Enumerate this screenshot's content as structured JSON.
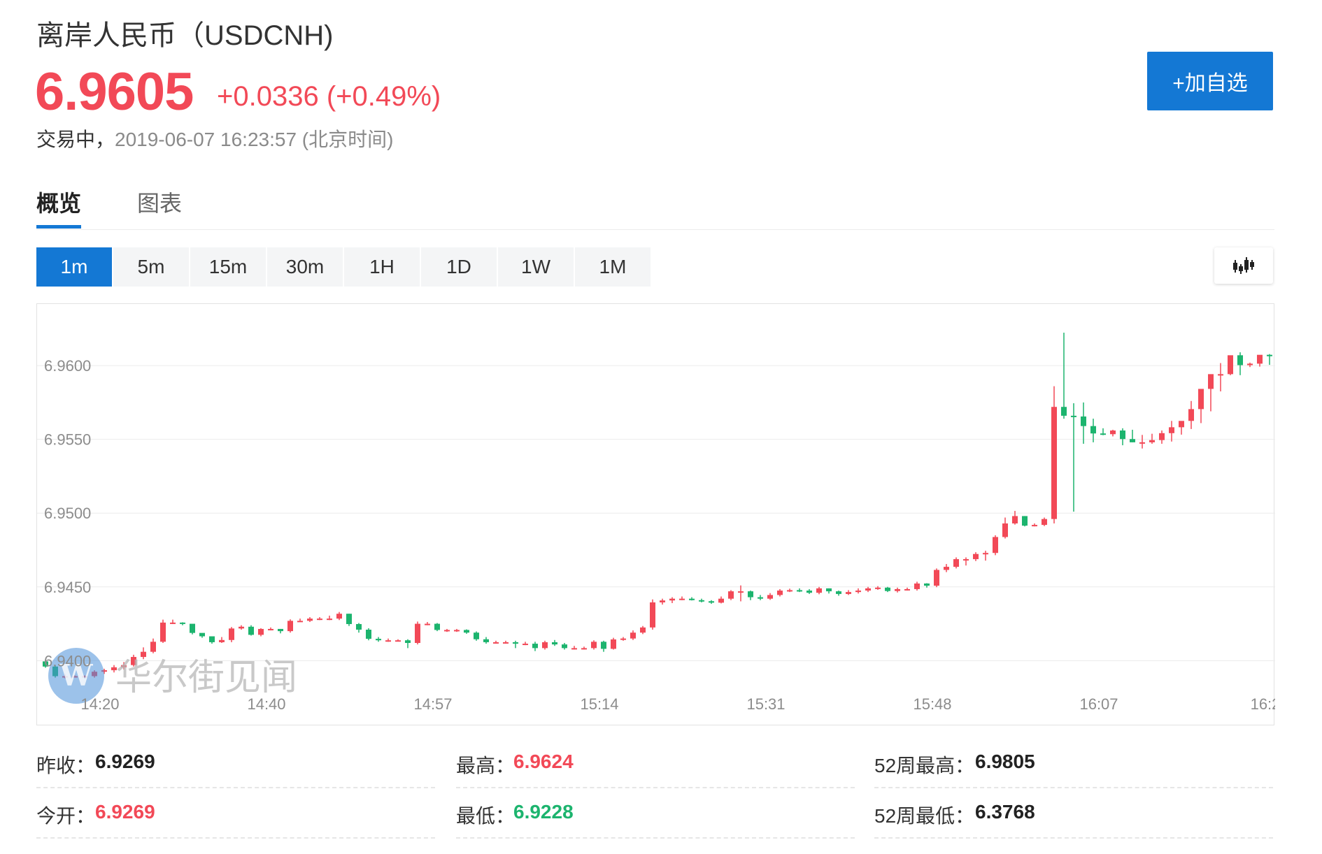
{
  "header": {
    "title": "离岸人民币（USDCNH)",
    "price": "6.9605",
    "change": "+0.0336 (+0.49%)",
    "status": "交易中，",
    "timestamp": "2019-06-07 16:23:57 (北京时间)",
    "add_button": "+加自选",
    "accent": "#1478d4",
    "up_color": "#f24957",
    "down_color": "#1cb46e"
  },
  "tabs": [
    {
      "label": "概览",
      "active": true
    },
    {
      "label": "图表",
      "active": false
    }
  ],
  "periods": [
    {
      "label": "1m",
      "active": true
    },
    {
      "label": "5m",
      "active": false
    },
    {
      "label": "15m",
      "active": false
    },
    {
      "label": "30m",
      "active": false
    },
    {
      "label": "1H",
      "active": false
    },
    {
      "label": "1D",
      "active": false
    },
    {
      "label": "1W",
      "active": false
    },
    {
      "label": "1M",
      "active": false
    }
  ],
  "chart_toggle_icon": "candlestick-icon",
  "watermark": {
    "icon": "wallstreetcn-logo-icon",
    "text": "华尔街见闻"
  },
  "chart_data": {
    "type": "candlestick",
    "y_ticks": [
      "6.9600",
      "6.9550",
      "6.9500",
      "6.9450",
      "6.9400"
    ],
    "x_ticks": [
      "14:20",
      "14:40",
      "14:57",
      "15:14",
      "15:31",
      "15:48",
      "16:07",
      "16:2"
    ],
    "ylim": [
      6.9385,
      6.9637
    ],
    "grid": true,
    "up_color": "#f24957",
    "down_color": "#1cb46e",
    "series": {
      "o": [
        6.93995,
        6.9396,
        6.93895,
        6.93895,
        6.93895,
        6.93895,
        6.93925,
        6.93935,
        6.93955,
        6.9397,
        6.94025,
        6.9406,
        6.94128,
        6.94258,
        6.94258,
        6.9425,
        6.94188,
        6.94165,
        6.94125,
        6.9414,
        6.94218,
        6.9423,
        6.94175,
        6.94215,
        6.94215,
        6.942,
        6.9427,
        6.9427,
        6.94285,
        6.94285,
        6.94285,
        6.94318,
        6.94248,
        6.9421,
        6.94148,
        6.94138,
        6.94138,
        6.94138,
        6.9412,
        6.9425,
        6.9425,
        6.94208,
        6.94208,
        6.94208,
        6.9419,
        6.94145,
        6.94125,
        6.94125,
        6.94125,
        6.94115,
        6.94115,
        6.94085,
        6.94125,
        6.9411,
        6.94085,
        6.94085,
        6.94085,
        6.94128,
        6.9408,
        6.94144,
        6.9415,
        6.9419,
        6.94225,
        6.94395,
        6.94408,
        6.9442,
        6.9442,
        6.9441,
        6.94403,
        6.94393,
        6.9442,
        6.9447,
        6.9447,
        6.9443,
        6.9442,
        6.94445,
        6.94475,
        6.94478,
        6.94475,
        6.9446,
        6.9449,
        6.9447,
        6.94452,
        6.94465,
        6.94475,
        6.9449,
        6.94495,
        6.94472,
        6.94485,
        6.94485,
        6.94523,
        6.94508,
        6.94615,
        6.94636,
        6.94688,
        6.94688,
        6.94723,
        6.9473,
        6.94838,
        6.9493,
        6.9498,
        6.94915,
        6.9492,
        6.9496,
        6.9572,
        6.9566,
        6.95655,
        6.9559,
        6.9554,
        6.95535,
        6.9556,
        6.95502,
        6.9548,
        6.9548,
        6.95495,
        6.95542,
        6.95582,
        6.95625,
        6.95705,
        6.95842,
        6.95942,
        6.95942,
        6.9607,
        6.96003,
        6.96013,
        6.96073
      ],
      "c": [
        6.9396,
        6.93895,
        6.93895,
        6.93895,
        6.93895,
        6.93925,
        6.93935,
        6.93955,
        6.9397,
        6.94025,
        6.9406,
        6.94128,
        6.94258,
        6.94258,
        6.9425,
        6.94188,
        6.94165,
        6.94125,
        6.9414,
        6.94218,
        6.9423,
        6.94175,
        6.94215,
        6.94215,
        6.942,
        6.9427,
        6.9427,
        6.94285,
        6.94285,
        6.94285,
        6.94318,
        6.94248,
        6.9421,
        6.94148,
        6.94138,
        6.94138,
        6.94138,
        6.9412,
        6.9425,
        6.9425,
        6.94208,
        6.94208,
        6.94208,
        6.9419,
        6.94145,
        6.94125,
        6.94125,
        6.94125,
        6.94115,
        6.94115,
        6.94085,
        6.94125,
        6.9411,
        6.94085,
        6.94085,
        6.94085,
        6.94128,
        6.9408,
        6.94144,
        6.9415,
        6.9419,
        6.94225,
        6.94395,
        6.94408,
        6.9442,
        6.9442,
        6.9441,
        6.94403,
        6.94393,
        6.9442,
        6.9447,
        6.9447,
        6.9443,
        6.9442,
        6.94445,
        6.94475,
        6.94478,
        6.94475,
        6.9446,
        6.9449,
        6.9447,
        6.94452,
        6.94465,
        6.94475,
        6.9449,
        6.94495,
        6.94472,
        6.94485,
        6.94485,
        6.94523,
        6.94508,
        6.94615,
        6.94636,
        6.94688,
        6.94688,
        6.94723,
        6.9473,
        6.94838,
        6.9493,
        6.9498,
        6.94915,
        6.9492,
        6.9496,
        6.9572,
        6.9566,
        6.95655,
        6.9559,
        6.9554,
        6.95535,
        6.9556,
        6.95502,
        6.9548,
        6.9548,
        6.95495,
        6.95542,
        6.95582,
        6.95625,
        6.95705,
        6.95842,
        6.95942,
        6.95942,
        6.9607,
        6.96003,
        6.96013,
        6.96073,
        6.96065
      ],
      "h": [
        6.94005,
        6.9397,
        6.9391,
        6.939,
        6.939,
        6.93935,
        6.93945,
        6.9397,
        6.9399,
        6.9404,
        6.9409,
        6.9415,
        6.94278,
        6.94278,
        6.9426,
        6.942,
        6.94175,
        6.94135,
        6.9416,
        6.94228,
        6.9424,
        6.9424,
        6.9422,
        6.94225,
        6.94215,
        6.9428,
        6.94285,
        6.94295,
        6.94295,
        6.94305,
        6.9433,
        6.94318,
        6.94255,
        6.9422,
        6.9416,
        6.9415,
        6.94145,
        6.94145,
        6.94265,
        6.94262,
        6.94255,
        6.94215,
        6.94215,
        6.94212,
        6.94198,
        6.9416,
        6.94135,
        6.94135,
        6.94135,
        6.94128,
        6.94128,
        6.94135,
        6.9414,
        6.9412,
        6.941,
        6.94095,
        6.94138,
        6.94135,
        6.94155,
        6.9416,
        6.94205,
        6.94235,
        6.94415,
        6.9442,
        6.9443,
        6.94435,
        6.9443,
        6.9442,
        6.9441,
        6.94435,
        6.94478,
        6.9451,
        6.94475,
        6.94445,
        6.94458,
        6.94485,
        6.94488,
        6.9449,
        6.94485,
        6.945,
        6.9449,
        6.94475,
        6.94478,
        6.9449,
        6.945,
        6.94505,
        6.945,
        6.94495,
        6.94495,
        6.94535,
        6.94525,
        6.94625,
        6.94655,
        6.947,
        6.947,
        6.94735,
        6.94745,
        6.9485,
        6.9497,
        6.95015,
        6.9498,
        6.9493,
        6.9497,
        6.9586,
        6.96223,
        6.95745,
        6.9575,
        6.9564,
        6.95575,
        6.95565,
        6.95575,
        6.95565,
        6.9553,
        6.95538,
        6.9556,
        6.95625,
        6.9561,
        6.9576,
        6.95758,
        6.9586,
        6.96017,
        6.96028,
        6.9609,
        6.9602,
        6.96023,
        6.96078
      ],
      "l": [
        6.93952,
        6.93885,
        6.9388,
        6.93885,
        6.93885,
        6.93885,
        6.9391,
        6.9392,
        6.9394,
        6.9396,
        6.9401,
        6.9405,
        6.9412,
        6.94248,
        6.9424,
        6.94178,
        6.94155,
        6.94115,
        6.9412,
        6.94125,
        6.9421,
        6.9417,
        6.94165,
        6.94205,
        6.94185,
        6.9419,
        6.94262,
        6.94262,
        6.94275,
        6.94275,
        6.94275,
        6.94235,
        6.9419,
        6.94138,
        6.94128,
        6.94128,
        6.9413,
        6.94085,
        6.9411,
        6.9424,
        6.942,
        6.94195,
        6.94195,
        6.94182,
        6.94135,
        6.94115,
        6.94115,
        6.94115,
        6.94085,
        6.94105,
        6.94065,
        6.94075,
        6.941,
        6.94075,
        6.94075,
        6.94075,
        6.94075,
        6.9406,
        6.94075,
        6.94135,
        6.9414,
        6.9418,
        6.9421,
        6.9438,
        6.9439,
        6.9441,
        6.94408,
        6.94395,
        6.94385,
        6.94388,
        6.9441,
        6.94402,
        6.9441,
        6.9441,
        6.94412,
        6.94435,
        6.94465,
        6.94465,
        6.94452,
        6.9445,
        6.94455,
        6.9444,
        6.94445,
        6.94455,
        6.94465,
        6.9448,
        6.94465,
        6.94462,
        6.94475,
        6.94475,
        6.94495,
        6.94498,
        6.946,
        6.94625,
        6.94645,
        6.94675,
        6.94678,
        6.94715,
        6.94828,
        6.94922,
        6.9491,
        6.9491,
        6.94912,
        6.9493,
        6.9564,
        6.9501,
        6.9547,
        6.9548,
        6.95528,
        6.9552,
        6.9546,
        6.9548,
        6.95438,
        6.9547,
        6.9547,
        6.95485,
        6.95532,
        6.9557,
        6.9561,
        6.9569,
        6.95825,
        6.95935,
        6.95935,
        6.9599,
        6.95993,
        6.96005
      ]
    }
  },
  "stats": [
    {
      "label": "昨收：",
      "value": "6.9269",
      "color": "#222222"
    },
    {
      "label": "最高：",
      "value": "6.9624",
      "color": "#f24957"
    },
    {
      "label": "52周最高：",
      "value": "6.9805",
      "color": "#222222"
    },
    {
      "label": "今开：",
      "value": "6.9269",
      "color": "#f24957"
    },
    {
      "label": "最低：",
      "value": "6.9228",
      "color": "#1cb46e"
    },
    {
      "label": "52周最低：",
      "value": "6.3768",
      "color": "#222222"
    }
  ]
}
